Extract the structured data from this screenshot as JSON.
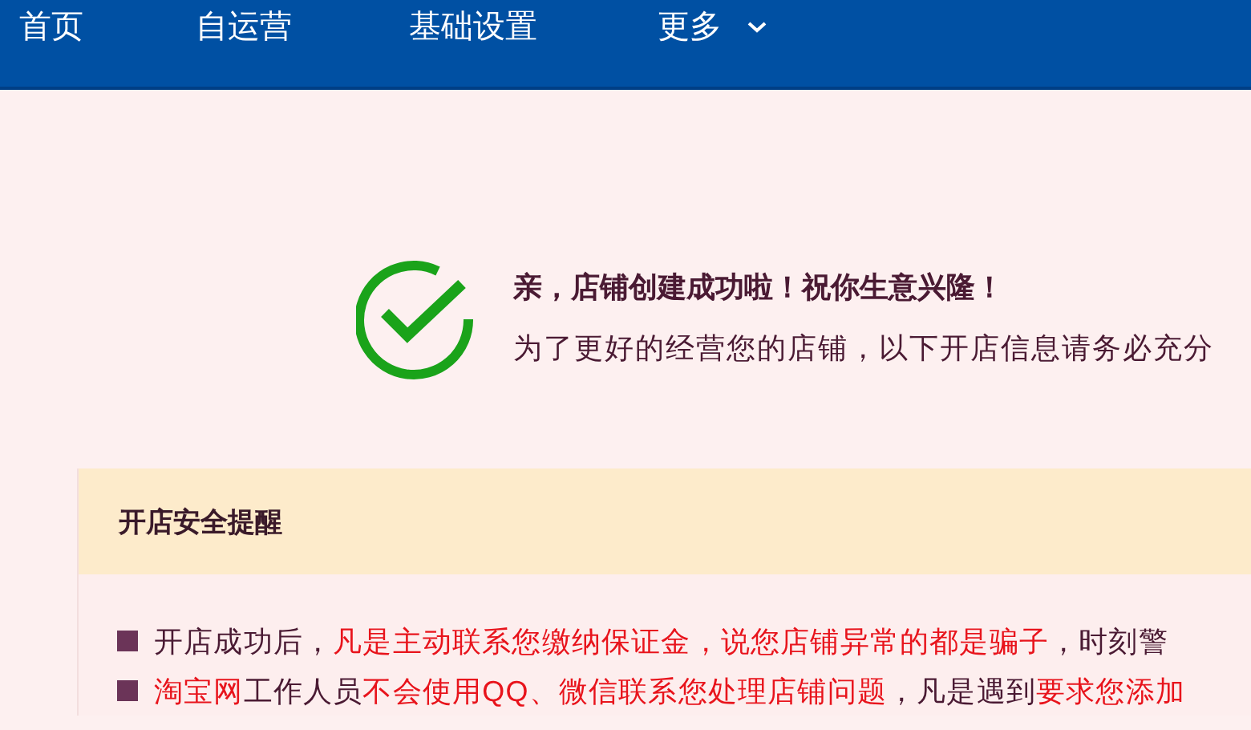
{
  "nav": {
    "items": [
      {
        "label": "首页",
        "dropdown": false
      },
      {
        "label": "自运营",
        "dropdown": false
      },
      {
        "label": "基础设置",
        "dropdown": false
      },
      {
        "label": "更多",
        "dropdown": true
      }
    ]
  },
  "success": {
    "title": "亲，店铺创建成功啦！祝你生意兴隆！",
    "subtitle": "为了更好的经营您的店铺，以下开店信息请务必充分"
  },
  "notice": {
    "title": "开店安全提醒",
    "items": [
      {
        "segments": [
          {
            "text": "开店成功后，",
            "highlight": false
          },
          {
            "text": "凡是主动联系您缴纳保证金，说您店铺异常的都是骗子",
            "highlight": true
          },
          {
            "text": "，时刻警",
            "highlight": false
          }
        ]
      },
      {
        "segments": [
          {
            "text": "淘宝网",
            "highlight": true
          },
          {
            "text": "工作人员",
            "highlight": false
          },
          {
            "text": "不会使用QQ、微信联系您处理店铺问题",
            "highlight": true
          },
          {
            "text": "，凡是遇到",
            "highlight": false
          },
          {
            "text": "要求您添加",
            "highlight": true
          }
        ]
      }
    ]
  }
}
